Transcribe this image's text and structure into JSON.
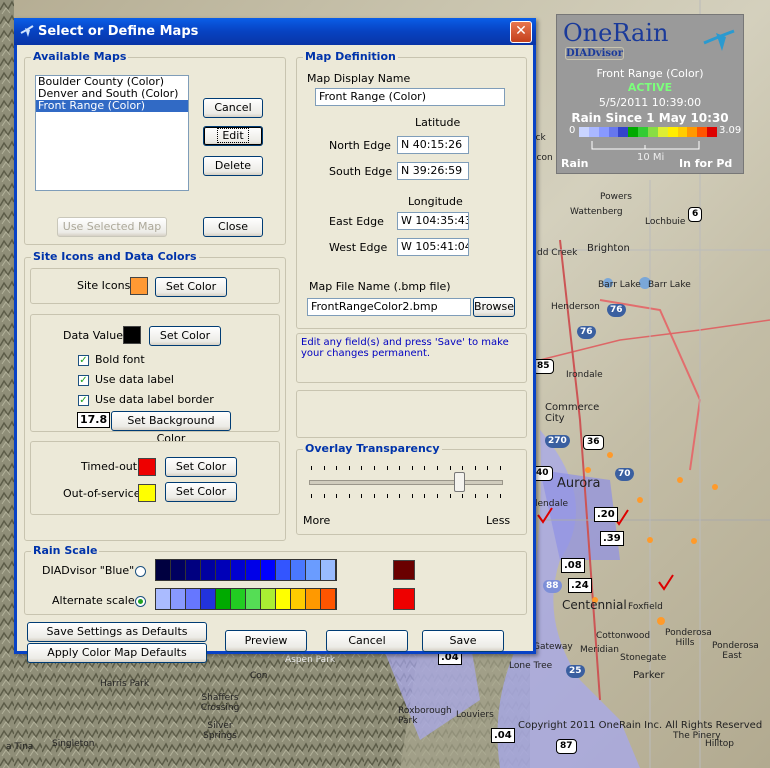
{
  "window": {
    "title": "Select or Define Maps",
    "close_label": "✕"
  },
  "available_maps": {
    "title": "Available Maps",
    "items": [
      "Boulder County (Color)",
      "Denver and South (Color)",
      "Front Range (Color)"
    ],
    "selected": "Front Range (Color)",
    "cancel": "Cancel",
    "edit": "Edit",
    "delete": "Delete",
    "use_selected": "Use Selected Map",
    "close": "Close"
  },
  "map_definition": {
    "title": "Map Definition",
    "display_name_label": "Map Display Name",
    "display_name": "Front Range (Color)",
    "latitude_label": "Latitude",
    "north_label": "North Edge",
    "north": "N  40:15:26",
    "south_label": "South Edge",
    "south": "N  39:26:59",
    "longitude_label": "Longitude",
    "east_label": "East Edge",
    "east": "W 104:35:43",
    "west_label": "West Edge",
    "west": "W 105:41:04",
    "file_label": "Map File Name (.bmp file)",
    "file": "FrontRangeColor2.bmp",
    "browse": "Browse"
  },
  "info_text": "Edit any field(s) and press 'Save' to make your changes permanent.",
  "site_icons": {
    "title": "Site Icons and Data Colors",
    "site_icons_label": "Site Icons",
    "set_color": "Set Color",
    "data_values_label": "Data Values",
    "bold_font": "Bold font",
    "use_data_label": "Use data label",
    "use_data_label_border": "Use data label border",
    "sample_value": "17.8",
    "set_bg_color": "Set Background Color",
    "timed_out": "Timed-out",
    "out_of_service": "Out-of-service"
  },
  "overlay": {
    "title": "Overlay Transparency",
    "more": "More",
    "less": "Less",
    "value": 0.78
  },
  "rain_scale": {
    "title": "Rain Scale",
    "blue_label": "DIADvisor \"Blue\"",
    "alternate_label": "Alternate scale",
    "selected": "alternate",
    "blue_colors": [
      "#000040",
      "#000060",
      "#000080",
      "#0000a0",
      "#0000b8",
      "#0000d0",
      "#0000e8",
      "#0000ff",
      "#3355ff",
      "#4a78ff",
      "#6a9cff",
      "#99bbff"
    ],
    "alt_colors": [
      "#aabbff",
      "#8899ff",
      "#6677ff",
      "#2233dd",
      "#00aa00",
      "#22cc22",
      "#55dd55",
      "#aaee33",
      "#ffff00",
      "#ffcc00",
      "#ff9900",
      "#ff5500"
    ],
    "blue_out": "#6a0000",
    "alt_out": "#ee0000"
  },
  "footer": {
    "save_defaults": "Save Settings as Defaults",
    "apply_defaults": "Apply Color Map Defaults",
    "preview": "Preview",
    "cancel": "Cancel",
    "save": "Save"
  },
  "legend": {
    "logo": "OneRain",
    "logo_sub": "DIADvisor",
    "map_name": "Front Range (Color)",
    "status": "ACTIVE",
    "datetime": "5/5/2011  10:39:00",
    "rain_since": "Rain Since 1 May 10:30",
    "min": "0",
    "max": "3.09",
    "distance": "10 Mi",
    "rain": "Rain",
    "units": "In for Pd",
    "bar_colors": [
      "#c9d4ff",
      "#aab8ff",
      "#8899ff",
      "#6677ee",
      "#3344cc",
      "#00aa00",
      "#33cc33",
      "#88dd44",
      "#ddee33",
      "#ffee00",
      "#ffcc00",
      "#ff9900",
      "#ff5500",
      "#dd0000"
    ]
  },
  "map": {
    "places": [
      "Powers",
      "Wattenberg",
      "Lochbuie",
      "Brighton",
      "dd Creek",
      "Barr Lake",
      "Barr Lake",
      "Henderson",
      "Irondale",
      "Commerce City",
      "Aurora",
      "lendale",
      "Centennial",
      "Foxfield",
      "Cottonwood",
      "Ponderosa Hills",
      "Ponderosa East",
      "Gateway",
      "Meridian",
      "Stonegate",
      "Parker",
      "Lone Tree",
      "Harris Park",
      "Shaffers Crossing",
      "Silver Springs",
      "Singleton",
      "Roxborough Park",
      "Louviers",
      "The Pinery",
      "Hilltop",
      "Aspen Park",
      "Con",
      "a Tina",
      "ick",
      "acon"
    ],
    "data_values": [
      ".20",
      ".39",
      ".08",
      ".24",
      ".04",
      ".04"
    ],
    "shields": [
      "6",
      "76",
      "76",
      "85",
      "270",
      "36",
      "40",
      "70",
      "88",
      "25",
      "87"
    ],
    "copyright": "Copyright 2011 OneRain Inc. All Rights Reserved"
  }
}
